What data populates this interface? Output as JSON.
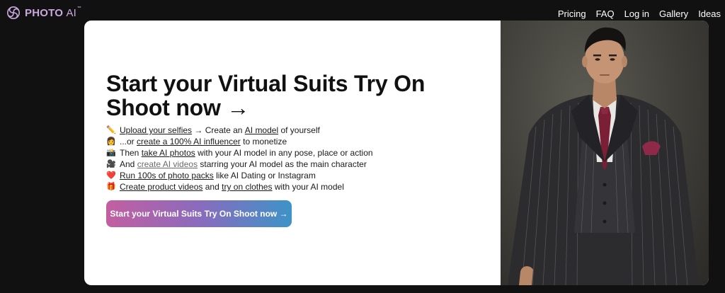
{
  "app": {
    "logo_text_main": "PHOTO",
    "logo_text_ai": "AI",
    "logo_tm": "™",
    "logo_icon": "swirl-logo-icon",
    "brand_color": "#c9a8dc"
  },
  "nav": {
    "items": [
      "Pricing",
      "FAQ",
      "Log in",
      "Gallery",
      "Ideas"
    ]
  },
  "hero": {
    "headline": "Start your Virtual Suits Try On Shoot now →",
    "features": [
      {
        "emoji": "✏️",
        "parts": [
          {
            "t": "link",
            "v": "Upload your selfies"
          },
          {
            "t": "text",
            "v": " → Create an "
          },
          {
            "t": "link",
            "v": "AI model"
          },
          {
            "t": "text",
            "v": " of yourself"
          }
        ]
      },
      {
        "emoji": "👩",
        "parts": [
          {
            "t": "text",
            "v": "...or "
          },
          {
            "t": "link",
            "v": "create a 100% AI influencer"
          },
          {
            "t": "text",
            "v": " to monetize"
          }
        ]
      },
      {
        "emoji": "📸",
        "parts": [
          {
            "t": "text",
            "v": "Then "
          },
          {
            "t": "link",
            "v": "take AI photos"
          },
          {
            "t": "text",
            "v": " with your AI model in any pose, place or action"
          }
        ]
      },
      {
        "emoji": "🎥",
        "parts": [
          {
            "t": "text",
            "v": "And "
          },
          {
            "t": "link-muted",
            "v": "create AI videos"
          },
          {
            "t": "text",
            "v": " starring your AI model as the main character"
          }
        ]
      },
      {
        "emoji": "❤️",
        "parts": [
          {
            "t": "link",
            "v": "Run 100s of photo packs"
          },
          {
            "t": "text",
            "v": " like AI Dating or Instagram"
          }
        ]
      },
      {
        "emoji": "🎁",
        "parts": [
          {
            "t": "link",
            "v": "Create product videos"
          },
          {
            "t": "text",
            "v": " and "
          },
          {
            "t": "link",
            "v": "try on clothes"
          },
          {
            "t": "text",
            "v": " with your AI model"
          }
        ]
      }
    ],
    "cta_label": "Start your Virtual Suits Try On Shoot now →",
    "cta_gradient": [
      "#c35fa0",
      "#8a6bbd",
      "#3d93c7"
    ]
  },
  "image": {
    "subject": "man in pinstripe three-piece suit with burgundy tie and pocket square"
  }
}
